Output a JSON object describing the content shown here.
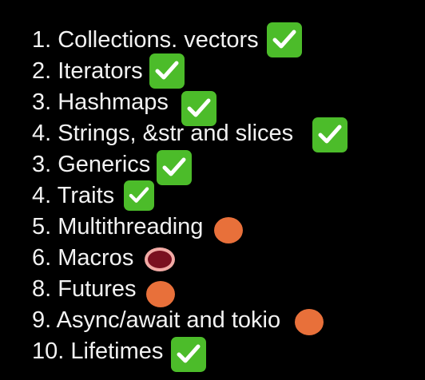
{
  "colors": {
    "background": "#000000",
    "text": "#f2f2f2",
    "check": "#4cbc2a",
    "in_progress": "#e8703a",
    "ring_fill": "#7a1020",
    "ring_stroke": "#f2aaa5"
  },
  "items": [
    {
      "label": "1. Collections. vectors",
      "status": "done",
      "icon": "check-mark-icon"
    },
    {
      "label": "2. Iterators",
      "status": "done",
      "icon": "check-mark-icon"
    },
    {
      "label": "3. Hashmaps",
      "status": "done",
      "icon": "check-mark-icon"
    },
    {
      "label": "4. Strings, &str and slices",
      "status": "done",
      "icon": "check-mark-icon"
    },
    {
      "label": "3. Generics",
      "status": "done",
      "icon": "check-mark-icon"
    },
    {
      "label": "4. Traits",
      "status": "done",
      "icon": "check-mark-icon"
    },
    {
      "label": "5. Multithreading",
      "status": "in-progress",
      "icon": "orange-dot-icon"
    },
    {
      "label": "6. Macros",
      "status": "in-progress",
      "icon": "red-ring-icon"
    },
    {
      "label": "8. Futures",
      "status": "in-progress",
      "icon": "orange-dot-icon"
    },
    {
      "label": "9. Async/await and tokio",
      "status": "in-progress",
      "icon": "orange-dot-icon"
    },
    {
      "label": "10. Lifetimes",
      "status": "done",
      "icon": "check-mark-icon"
    }
  ]
}
